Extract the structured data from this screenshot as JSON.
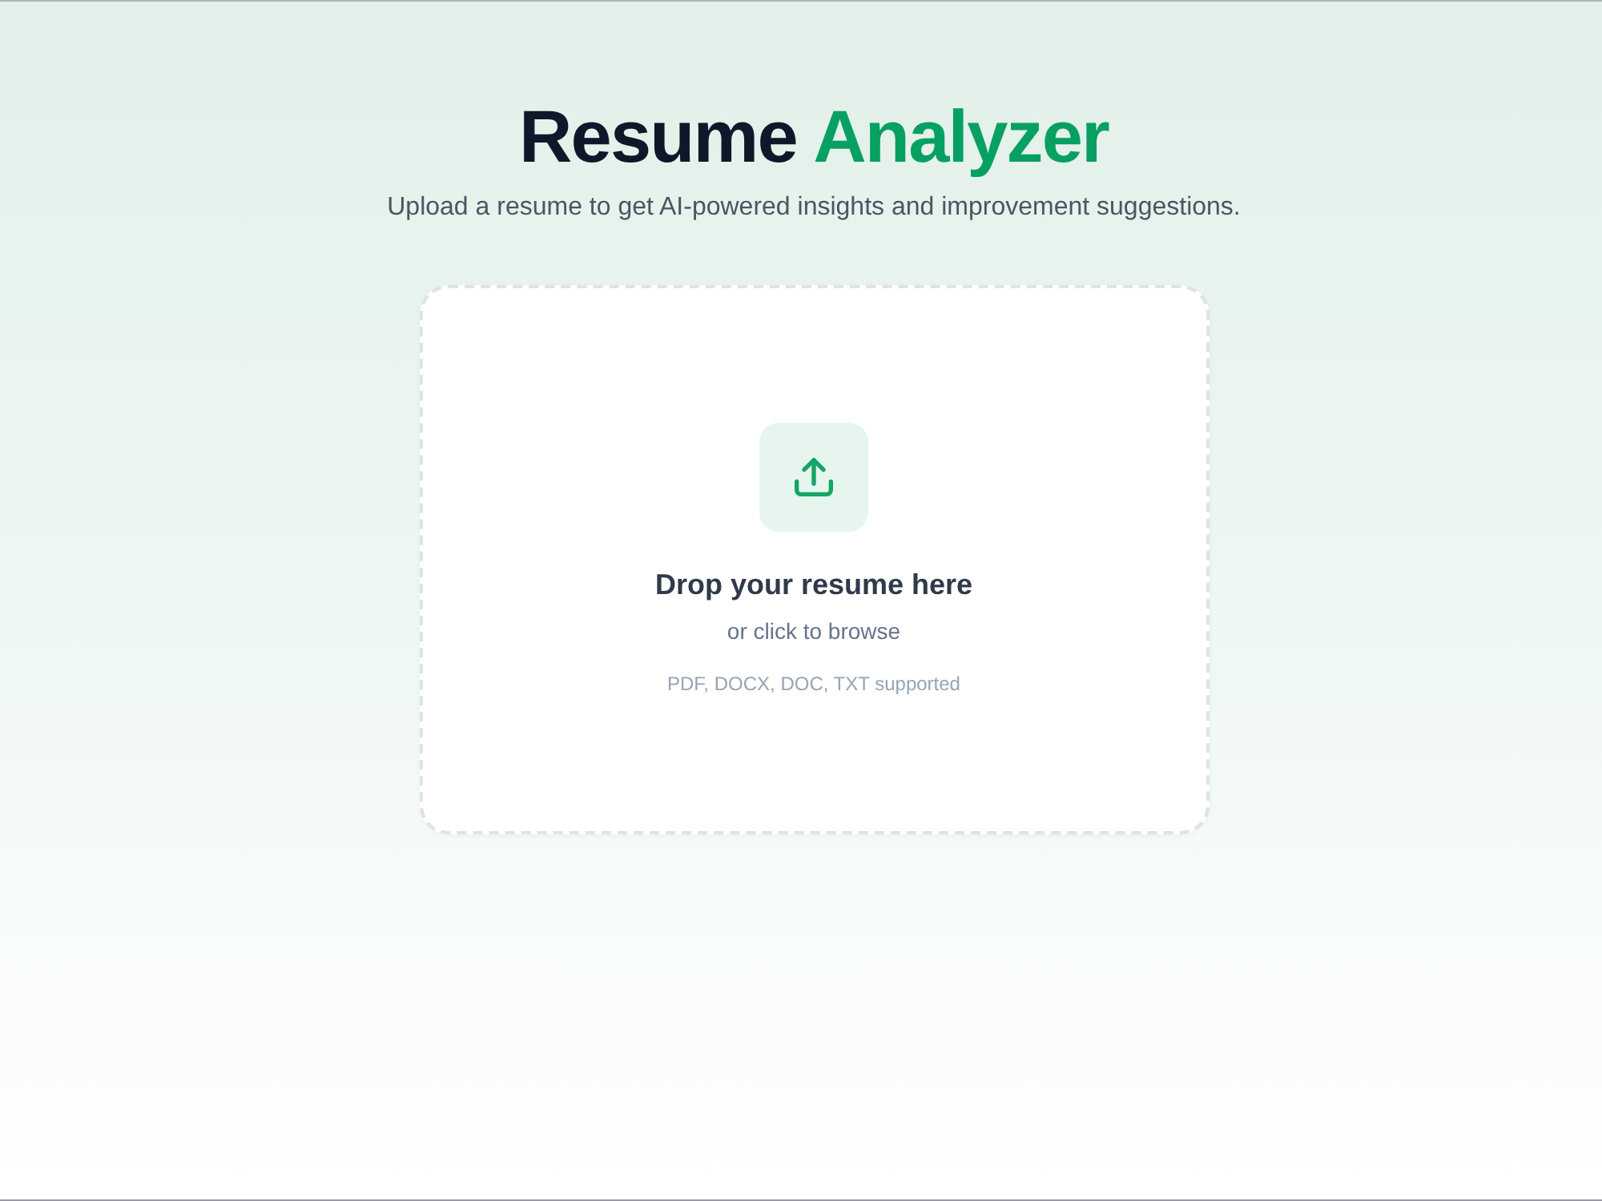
{
  "header": {
    "title_lead": "Resume",
    "title_accent": "Analyzer",
    "subtitle": "Upload a resume to get AI-powered insights and improvement suggestions."
  },
  "dropzone": {
    "heading": "Drop your resume here",
    "action": "or click to browse",
    "formats": "PDF, DOCX, DOC, TXT supported"
  }
}
